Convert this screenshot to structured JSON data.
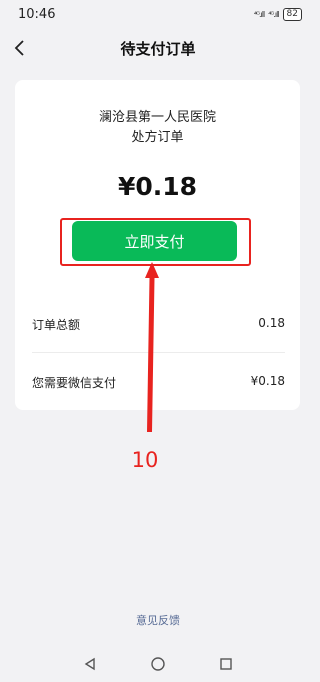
{
  "status_bar": {
    "time": "10:46",
    "signal_1": "⁴ᴳ.ıll",
    "signal_2": "⁴ᴳ.ıll",
    "battery": "82"
  },
  "header": {
    "title": "待支付订单"
  },
  "order": {
    "hospital": "澜沧县第一人民医院",
    "type": "处方订单",
    "amount": "¥0.18",
    "pay_button_label": "立即支付",
    "total_label": "订单总额",
    "total_value": "0.18",
    "wechat_label": "您需要微信支付",
    "wechat_value": "¥0.18"
  },
  "annotation": {
    "step_number": "10"
  },
  "footer": {
    "feedback_link": "意见反馈"
  },
  "colors": {
    "accent_green": "#09ba58",
    "annotation_red": "#e8231f",
    "link_blue": "#576b95"
  },
  "icons": [
    "back-chevron-icon",
    "triangle-back-icon",
    "circle-home-icon",
    "square-recents-icon"
  ]
}
